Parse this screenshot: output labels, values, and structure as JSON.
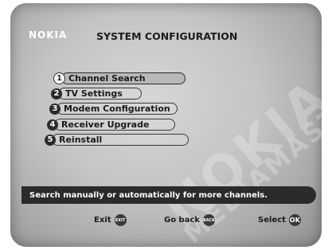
{
  "brand": "NOKIA",
  "title": "SYSTEM CONFIGURATION",
  "watermark": {
    "big": "NOKIA",
    "small": "MEDIAMASTER"
  },
  "menu": {
    "items": [
      {
        "num": "1",
        "label": "Channel Search"
      },
      {
        "num": "2",
        "label": "TV Settings"
      },
      {
        "num": "3",
        "label": "Modem Configuration"
      },
      {
        "num": "4",
        "label": "Receiver Upgrade"
      },
      {
        "num": "5",
        "label": "Reinstall"
      }
    ],
    "selected_index": 0
  },
  "help_text": "Search manually or automatically for more channels.",
  "footer": {
    "exit": {
      "label": "Exit",
      "key": "EXIT"
    },
    "back": {
      "label": "Go back",
      "key": "BACK"
    },
    "select": {
      "label": "Select",
      "key": "OK"
    }
  },
  "colors": {
    "background": "#c4c4c4",
    "text": "#1a1a1a",
    "bar": "#2b2b2b",
    "accent": "#ffffff"
  }
}
